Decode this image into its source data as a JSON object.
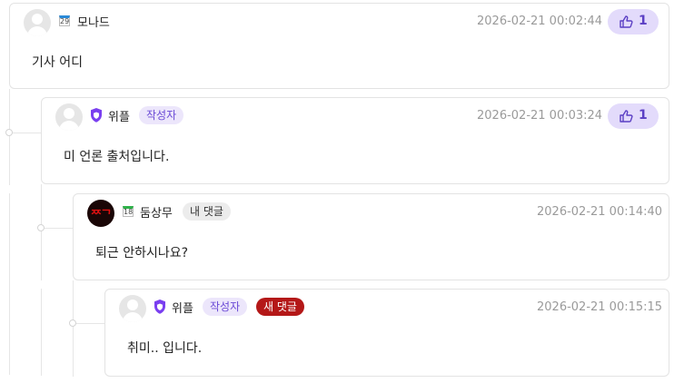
{
  "comments": [
    {
      "nickname": "모나드",
      "level": "29",
      "date": "2026-02-21 00:02:44",
      "likes": "1",
      "content": "기사 어디"
    },
    {
      "nickname": "위플",
      "author_badge": "작성자",
      "date": "2026-02-21 00:03:24",
      "likes": "1",
      "content": "미 언론 출처입니다."
    },
    {
      "nickname": "둠상무",
      "level": "18",
      "mine_badge": "내 댓글",
      "avatar_text": "ᄍᄀ",
      "date": "2026-02-21 00:14:40",
      "content": "퇴근 안하시나요?"
    },
    {
      "nickname": "위플",
      "author_badge": "작성자",
      "new_badge": "새 댓글",
      "date": "2026-02-21 00:15:15",
      "content": "취미.. 입니다."
    }
  ],
  "colors": {
    "accent": "#6b4ad6",
    "like_bg": "#e3dbfb",
    "new_badge": "#b41818",
    "level_blue": "#2a8ad8",
    "level_green": "#2fb24a"
  }
}
